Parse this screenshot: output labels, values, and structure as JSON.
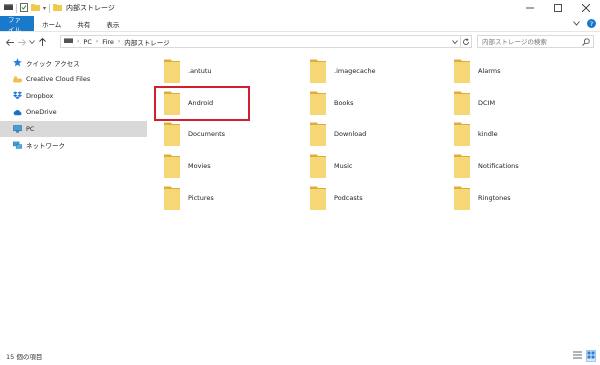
{
  "window": {
    "title": "内部ストレージ",
    "controls": [
      "minimize",
      "maximize",
      "close"
    ]
  },
  "ribbon": {
    "tabs": [
      "ファイル",
      "ホーム",
      "共有",
      "表示"
    ]
  },
  "address": {
    "path": [
      "PC",
      "Fire",
      "内部ストレージ"
    ],
    "search_placeholder": "内部ストレージの検索"
  },
  "sidebar": {
    "items": [
      {
        "label": "クイック アクセス",
        "icon": "star-icon"
      },
      {
        "label": "Creative Cloud Files",
        "icon": "creative-cloud-icon"
      },
      {
        "label": "Dropbox",
        "icon": "dropbox-icon"
      },
      {
        "label": "OneDrive",
        "icon": "cloud-icon"
      },
      {
        "label": "PC",
        "icon": "monitor-icon",
        "selected": true
      },
      {
        "label": "ネットワーク",
        "icon": "network-icon"
      }
    ]
  },
  "folders": [
    ".antutu",
    ".imagecache",
    "Alarms",
    "Android",
    "Books",
    "DCIM",
    "Documents",
    "Download",
    "kindle",
    "Movies",
    "Music",
    "Notifications",
    "Pictures",
    "Podcasts",
    "Ringtones"
  ],
  "highlighted_folder": "Android",
  "highlight_color": "#d21f2f",
  "accent_color": "#1979ca",
  "status": {
    "item_count": "15 個の項目"
  }
}
